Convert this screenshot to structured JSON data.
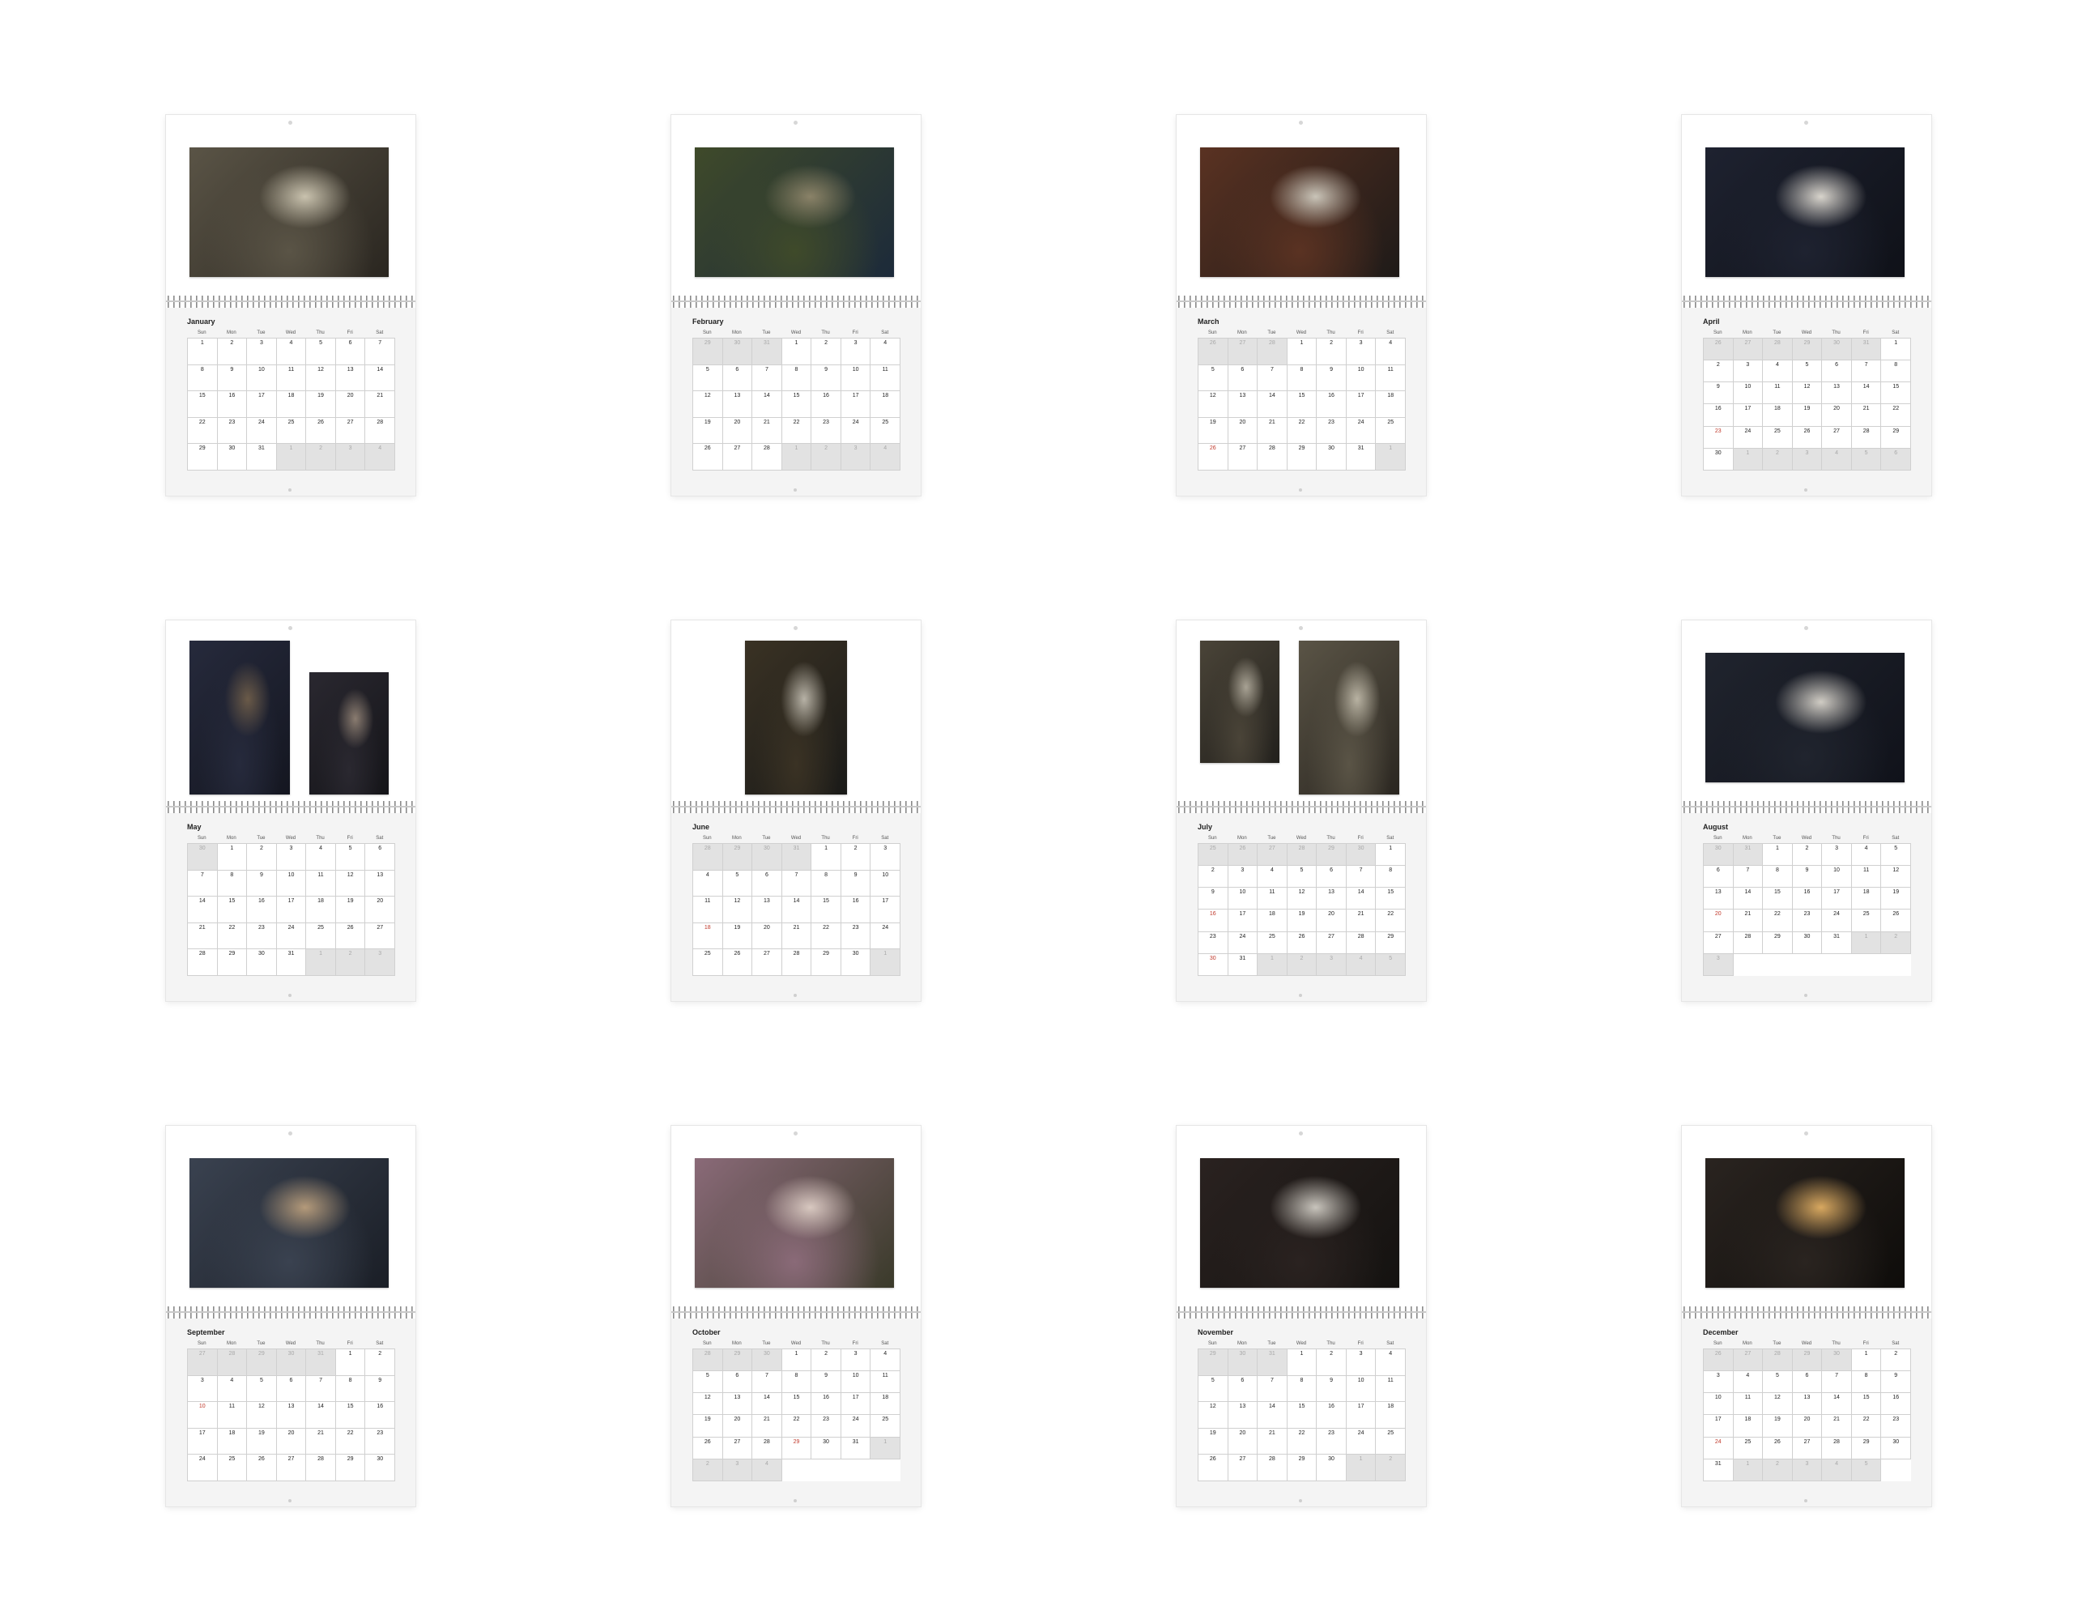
{
  "weekdays": [
    "Sun",
    "Mon",
    "Tue",
    "Wed",
    "Thu",
    "Fri",
    "Sat"
  ],
  "months": [
    {
      "name": "January",
      "prev_days": [],
      "days": 31,
      "next_days": [
        1,
        2,
        3,
        4
      ],
      "highlighted": [],
      "photos": [
        {
          "subject": "man-writing-by-window",
          "colors": [
            "#5a5446",
            "#2a2620",
            "#c9c2ae"
          ]
        }
      ]
    },
    {
      "name": "February",
      "prev_days": [
        29,
        30,
        31
      ],
      "days": 28,
      "next_days": [
        1,
        2,
        3,
        4
      ],
      "highlighted": [],
      "photos": [
        {
          "subject": "man-with-stone-statue",
          "colors": [
            "#3f4a2a",
            "#1c2a3a",
            "#8a8268"
          ]
        }
      ]
    },
    {
      "name": "March",
      "prev_days": [
        26,
        27,
        28
      ],
      "days": 31,
      "next_days": [
        1
      ],
      "highlighted": [
        26
      ],
      "photos": [
        {
          "subject": "man-on-leather-sofa",
          "colors": [
            "#5a3222",
            "#1e1a18",
            "#c9c4b8"
          ]
        }
      ]
    },
    {
      "name": "April",
      "prev_days": [
        26,
        27,
        28,
        29,
        30,
        31
      ],
      "days": 30,
      "next_days": [
        1,
        2,
        3,
        4,
        5,
        6
      ],
      "highlighted": [
        23
      ],
      "photos": [
        {
          "subject": "man-at-piano-portrait",
          "colors": [
            "#1e2230",
            "#0f1118",
            "#d8d4cc"
          ]
        }
      ]
    },
    {
      "name": "May",
      "prev_days": [
        30
      ],
      "days": 31,
      "next_days": [
        1,
        2,
        3
      ],
      "highlighted": [],
      "photos": [
        {
          "subject": "man-in-fedora",
          "colors": [
            "#262a3c",
            "#141620",
            "#6a5a48"
          ]
        },
        {
          "subject": "man-seated-checkered-floor",
          "colors": [
            "#2a2830",
            "#141418",
            "#8a7c70"
          ]
        }
      ]
    },
    {
      "name": "June",
      "prev_days": [
        28,
        29,
        30,
        31
      ],
      "days": 30,
      "next_days": [
        1
      ],
      "highlighted": [
        18
      ],
      "photos": [
        {
          "subject": "man-in-library-with-cane",
          "colors": [
            "#3a3224",
            "#1a1a18",
            "#b7b2a6"
          ]
        }
      ]
    },
    {
      "name": "July",
      "prev_days": [
        25,
        26,
        27,
        28,
        29,
        30
      ],
      "days": 31,
      "next_days": [
        1,
        2,
        3,
        4,
        5
      ],
      "highlighted": [
        16,
        30
      ],
      "photos": [
        {
          "subject": "man-portrait-left",
          "colors": [
            "#4a4438",
            "#22201c",
            "#a8a294"
          ]
        },
        {
          "subject": "man-portrait-right",
          "colors": [
            "#5a5446",
            "#2a2620",
            "#b8b2a2"
          ]
        }
      ]
    },
    {
      "name": "August",
      "prev_days": [
        30,
        31
      ],
      "days": 31,
      "next_days": [
        1,
        2,
        3
      ],
      "highlighted": [
        20
      ],
      "photos": [
        {
          "subject": "man-at-piano-white-sweater",
          "colors": [
            "#20242e",
            "#10121a",
            "#d0ccc4"
          ]
        }
      ]
    },
    {
      "name": "September",
      "prev_days": [
        27,
        28,
        29,
        30,
        31
      ],
      "days": 30,
      "next_days": [],
      "highlighted": [
        10
      ],
      "photos": [
        {
          "subject": "man-with-magnifying-glass",
          "colors": [
            "#3a4250",
            "#1a1e26",
            "#b49a7a"
          ]
        }
      ]
    },
    {
      "name": "October",
      "prev_days": [
        28,
        29,
        30
      ],
      "days": 31,
      "next_days": [
        1,
        2,
        3,
        4
      ],
      "highlighted": [
        29
      ],
      "photos": [
        {
          "subject": "man-in-white-suit-wisteria",
          "colors": [
            "#8a6a78",
            "#3a3a2a",
            "#d8c8c0"
          ]
        }
      ]
    },
    {
      "name": "November",
      "prev_days": [
        29,
        30,
        31
      ],
      "days": 30,
      "next_days": [
        1,
        2
      ],
      "highlighted": [],
      "photos": [
        {
          "subject": "man-seated-black-white-floor",
          "colors": [
            "#2a2220",
            "#141210",
            "#c8c4bc"
          ]
        }
      ]
    },
    {
      "name": "December",
      "prev_days": [
        26,
        27,
        28,
        29,
        30
      ],
      "days": 31,
      "next_days": [
        1,
        2,
        3,
        4,
        5
      ],
      "highlighted": [
        24
      ],
      "photos": [
        {
          "subject": "man-with-candles",
          "colors": [
            "#2a2420",
            "#0e0c0a",
            "#d8a860"
          ]
        }
      ]
    }
  ]
}
